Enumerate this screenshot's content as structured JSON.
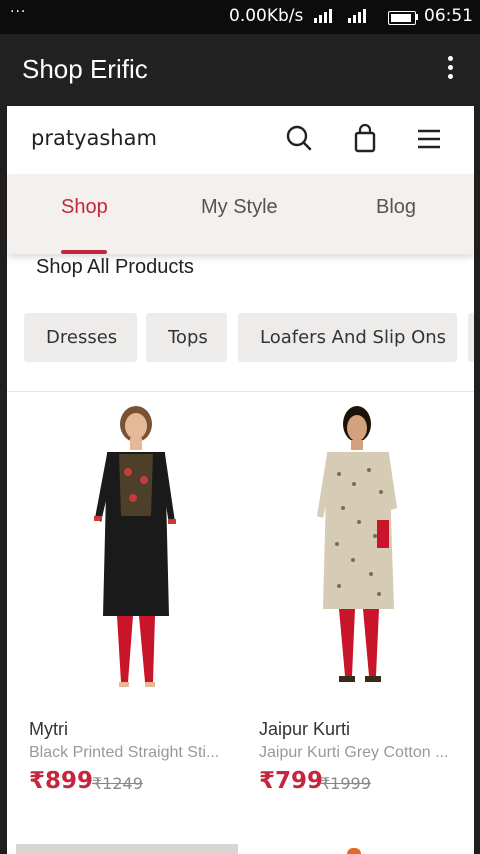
{
  "status_bar": {
    "notification_dots": "···",
    "network_speed": "0.00Kb/s",
    "signal_text": "4G 4G 3G",
    "time": "06:51"
  },
  "app_bar": {
    "title": "Shop Erific",
    "more_icon": "more-vertical-icon"
  },
  "site_header": {
    "logo": "pratyasham",
    "icons": [
      "search-icon",
      "shopping-bag-icon",
      "menu-icon"
    ]
  },
  "nav_tabs": [
    {
      "label": "Shop",
      "active": true
    },
    {
      "label": "My Style",
      "active": false
    },
    {
      "label": "Blog",
      "active": false
    }
  ],
  "section_title": "Shop All Products",
  "categories": [
    "Dresses",
    "Tops",
    "Loafers And Slip Ons"
  ],
  "products": [
    {
      "brand": "Mytri",
      "description": "Black Printed Straight Sti...",
      "price": "₹899",
      "mrp": "₹1249"
    },
    {
      "brand": "Jaipur Kurti",
      "description": "Jaipur Kurti Grey Cotton ...",
      "price": "₹799",
      "mrp": "₹1999"
    }
  ],
  "colors": {
    "accent": "#c4273d",
    "app_bar": "#212121",
    "status_bar": "#0c0c0c",
    "tab_background": "#f3f0ed",
    "chip_background": "#eeeceb"
  }
}
